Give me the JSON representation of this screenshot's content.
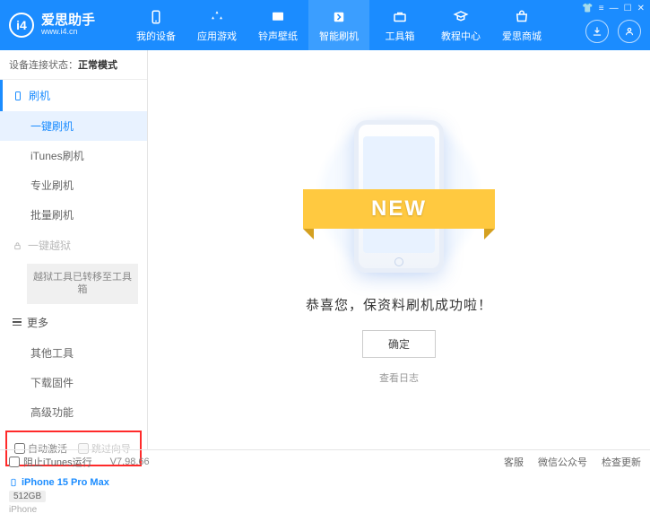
{
  "header": {
    "appName": "爱思助手",
    "appUrl": "www.i4.cn",
    "logoLetter": "i4",
    "tabs": [
      {
        "label": "我的设备"
      },
      {
        "label": "应用游戏"
      },
      {
        "label": "铃声壁纸"
      },
      {
        "label": "智能刷机"
      },
      {
        "label": "工具箱"
      },
      {
        "label": "教程中心"
      },
      {
        "label": "爱思商城"
      }
    ],
    "activeTab": 3
  },
  "sidebar": {
    "statusLabel": "设备连接状态：",
    "statusMode": "正常模式",
    "groupFlash": "刷机",
    "items": [
      {
        "label": "一键刷机"
      },
      {
        "label": "iTunes刷机"
      },
      {
        "label": "专业刷机"
      },
      {
        "label": "批量刷机"
      }
    ],
    "groupJailbreak": "一键越狱",
    "jailbreakNote": "越狱工具已转移至工具箱",
    "groupMore": "更多",
    "moreItems": [
      {
        "label": "其他工具"
      },
      {
        "label": "下载固件"
      },
      {
        "label": "高级功能"
      }
    ],
    "checkAutoActivate": "自动激活",
    "checkSkipGuide": "跳过向导",
    "deviceName": "iPhone 15 Pro Max",
    "deviceStorage": "512GB",
    "deviceType": "iPhone"
  },
  "main": {
    "ribbonText": "NEW",
    "successMsg": "恭喜您，保资料刷机成功啦！",
    "confirmLabel": "确定",
    "viewLog": "查看日志"
  },
  "footer": {
    "blockItunes": "阻止iTunes运行",
    "version": "V7.98.66",
    "links": [
      "客服",
      "微信公众号",
      "检查更新"
    ]
  }
}
